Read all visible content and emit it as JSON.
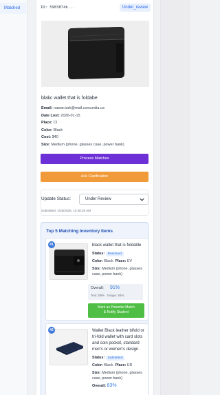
{
  "sidebar": {
    "matched_tab": "Matched"
  },
  "lost_item": {
    "id_text": "ID: 5983874b...",
    "status_badge": "Under_review",
    "title": "blakc wallet that is foldabe",
    "email_label": "Email:",
    "email": "nawar.turk@mail.concordia.ca",
    "date_label": "Date Lost:",
    "date": "2026-01-15",
    "place_label": "Place:",
    "place": "CI",
    "color_label": "Color:",
    "color": "Black",
    "cost_label": "Cost:",
    "cost": "$40",
    "size_label": "Size:",
    "size": "Medium (phone, glasses case, power bank)"
  },
  "actions": {
    "process_label": "Process Matches",
    "ask_label": "Ask Clarification"
  },
  "status_update": {
    "label": "Update Status:",
    "selected": "Under Review",
    "submitted": "Submitted: 1/25/2026, 10:48:28 AM"
  },
  "matches": {
    "title": "Top 5 Matching Inventory Items",
    "items": [
      {
        "rank": "#1",
        "name": "black wallet that is foldable",
        "status_label": "Status:",
        "status": "Resolved",
        "color_label": "Color:",
        "color": "Black",
        "place_label": "Place:",
        "place": "EV",
        "size_label": "Size:",
        "size": "Medium (phone, glasses case, power bank)",
        "overall_label": "Overall:",
        "overall": "91%",
        "text_score": "Text: 89%",
        "image_score": "Image: 93%",
        "action_label_1": "Mark as Potential Match",
        "action_label_2": "& Notify Student"
      },
      {
        "rank": "#2",
        "name": "Wallet Black leather bifold or tri-fold wallet with card slots and coin pocket, standard men's or women's design.",
        "status_label": "Status:",
        "status": "Submitted",
        "color_label": "Color:",
        "color": "Black",
        "place_label": "Place:",
        "place": "ER",
        "size_label": "Size:",
        "size": "Medium (phone, glasses case, power bank)",
        "overall_label": "Overall:",
        "overall": "83%"
      }
    ]
  }
}
